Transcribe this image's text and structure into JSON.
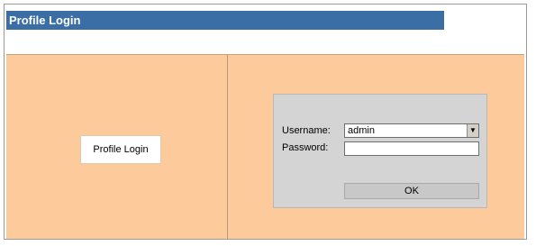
{
  "header": {
    "title": "Profile Login"
  },
  "left_pane": {
    "label": "Profile Login"
  },
  "login_form": {
    "username_label": "Username:",
    "username_value": "admin",
    "password_label": "Password:",
    "password_value": "",
    "ok_label": "OK"
  },
  "colors": {
    "title_bar": "#3a6ea5",
    "content_background": "#fdcb9b",
    "panel_background": "#d4d4d4"
  },
  "icons": {
    "dropdown": "chevron-down-icon"
  }
}
